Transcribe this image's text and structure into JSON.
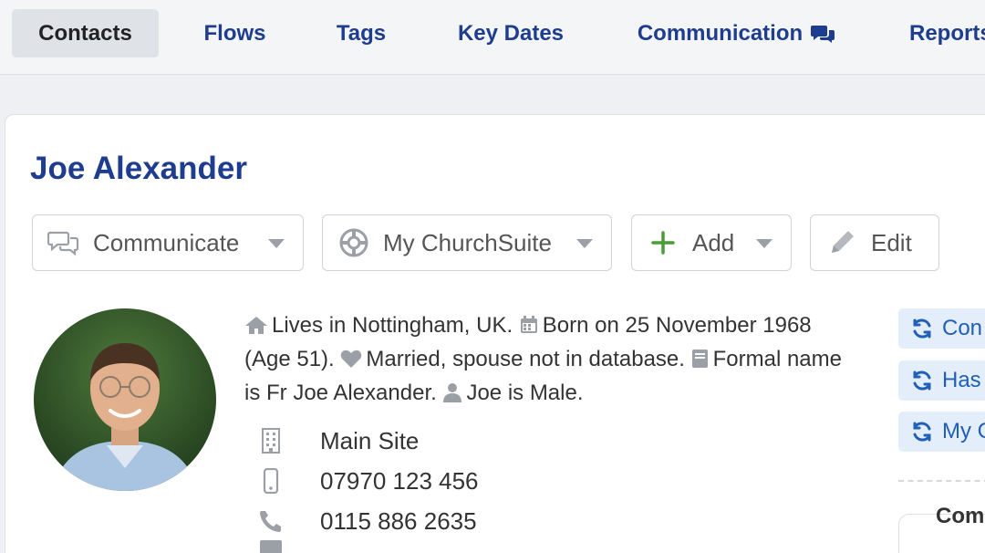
{
  "nav": {
    "tabs": [
      {
        "label": "Contacts",
        "active": true
      },
      {
        "label": "Flows"
      },
      {
        "label": "Tags"
      },
      {
        "label": "Key Dates"
      },
      {
        "label": "Communication"
      },
      {
        "label": "Reports"
      }
    ]
  },
  "person": {
    "name": "Joe Alexander",
    "info": {
      "lives": "Lives in Nottingham, UK.",
      "born": "Born on 25 November 1968 (Age 51).",
      "married": "Married, spouse not in database.",
      "formal": "Formal name is Fr Joe Alexander.",
      "gender": "Joe is Male."
    },
    "details": {
      "site": "Main Site",
      "mobile": "07970 123 456",
      "phone": "0115 886 2635"
    }
  },
  "actions": {
    "communicate": "Communicate",
    "my_churchsuite": "My ChurchSuite",
    "add": "Add",
    "edit": "Edit"
  },
  "flows": [
    {
      "label": "Con"
    },
    {
      "label": "Has"
    },
    {
      "label": "My C"
    }
  ],
  "panel": {
    "comm_title": "Com"
  },
  "colors": {
    "brand": "#1f3d8f",
    "add_green": "#4a9c3a",
    "flow_bg": "#e4eefb"
  }
}
